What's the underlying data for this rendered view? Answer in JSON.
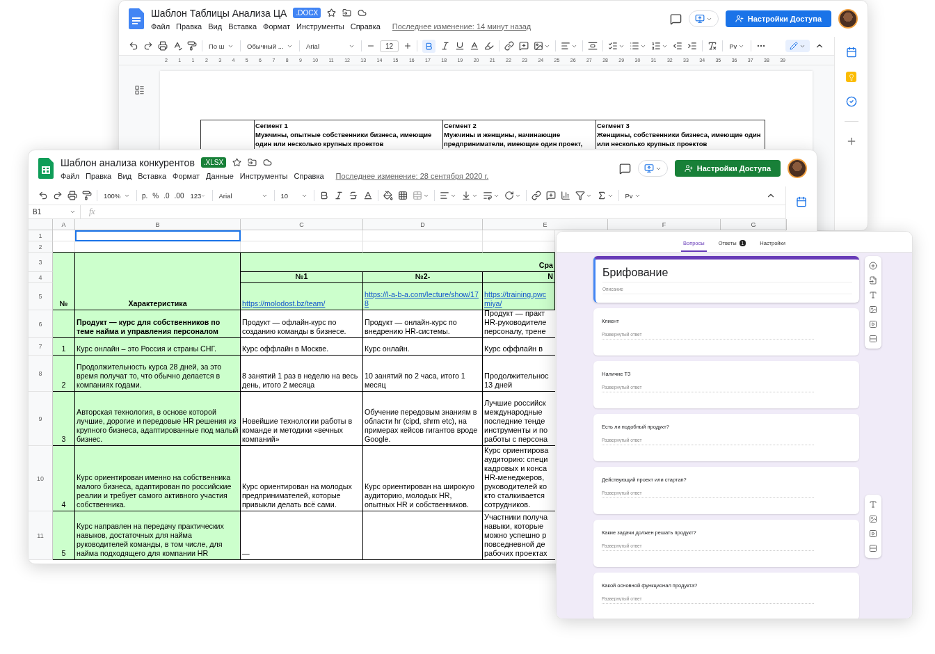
{
  "docs": {
    "title": "Шаблон Таблицы Анализа ЦА",
    "badge": ".DOCX",
    "menus": [
      "Файл",
      "Правка",
      "Вид",
      "Вставка",
      "Формат",
      "Инструменты",
      "Справка"
    ],
    "last_edit": "Последнее изменение: 14 минут назад",
    "share": "Настройки Доступа",
    "toolbar": {
      "style_short": "По ш",
      "paragraph_style": "Обычный ...",
      "font": "Arial",
      "font_size": "12",
      "bold_active": true,
      "input_tools": "Рv"
    },
    "ruler": [
      "2",
      "1",
      "1",
      "2",
      "3",
      "4",
      "5",
      "6",
      "7",
      "8",
      "9",
      "10",
      "11",
      "12",
      "13",
      "14",
      "15",
      "16",
      "17",
      "18",
      "19",
      "20",
      "21",
      "22",
      "23",
      "24",
      "25",
      "26",
      "27",
      "28",
      "29",
      "30",
      "31",
      "32",
      "33",
      "34",
      "35",
      "36",
      "37",
      "38",
      "39"
    ],
    "table": [
      {
        "title": "Сегмент 1",
        "text": "Мужчины, опытные собственники бизнеса, имеющие один или несколько крупных проектов"
      },
      {
        "title": "Сегмент 2",
        "text": "Мужчины и женщины, начинающие предприниматели, имеющие один проект,"
      },
      {
        "title": "Сегмент 3",
        "text": "Женщины, собственники бизнеса, имеющие один или несколько крупных проектов"
      }
    ]
  },
  "sheets": {
    "title": "Шаблон анализа конкурентов",
    "badge": ".XLSX",
    "menus": [
      "Файл",
      "Правка",
      "Вид",
      "Вставка",
      "Формат",
      "Данные",
      "Инструменты",
      "Справка"
    ],
    "last_edit": "Последнее изменение: 28 сентября 2020 г.",
    "share": "Настройки Доступа",
    "toolbar": {
      "zoom": "100%",
      "currency": "р.",
      "percent": "%",
      "decrease_decimal": ".0",
      "increase_decimal": ".00",
      "number_format": "123",
      "font": "Arial",
      "font_size": "10",
      "input_tools": "Рv"
    },
    "name_box": "B1",
    "formula_icon": "fx",
    "columns": [
      "A",
      "B",
      "C",
      "D",
      "E",
      "F",
      "G"
    ],
    "row_numbers": [
      "1",
      "2",
      "3",
      "4",
      "5",
      "6",
      "7",
      "8",
      "9",
      "10",
      "11"
    ],
    "blank_rows": [
      {
        "selected": true
      },
      {
        "selected": false
      }
    ],
    "header": {
      "number": "№",
      "characteristic": "Характеристика",
      "compare": "Сра",
      "competitors": [
        {
          "name": "№1",
          "link": [
            "https://molodost.bz/team/"
          ]
        },
        {
          "name": "№2-",
          "link": [
            "https://l-a-b-a.com/lecture/show/178"
          ]
        },
        {
          "name": "N",
          "link": [
            "https://training.pwc",
            "miya/"
          ]
        }
      ]
    },
    "rows": [
      {
        "text": "Продукт — курс для собственников по теме найма и управления персоналом",
        "bold": true,
        "cells": [
          "Продукт — офлайн-курс по созданию команды в бизнесе.",
          "Продукт — онлайн-курс по внедрению HR-системы."
        ],
        "cut": [
          "Продукт — практ",
          "HR-руководителе",
          "персоналу, трене"
        ]
      },
      {
        "number": "1",
        "text": "Курс онлайн – это Россия и страны СНГ.",
        "bold": false,
        "cells": [
          "Курс оффлайн в Москве.",
          "Курс онлайн."
        ],
        "cut": [
          "Курс оффлайн в"
        ]
      },
      {
        "number": "2",
        "text": "Продолжительность курса 28 дней, за это время получат то, что обычно делается в компаниях годами.",
        "bold": false,
        "cells": [
          "8 занятий 1 раз в неделю на весь день, итого 2 месяца",
          "10 занятий по 2 часа, итого 1 месяц"
        ],
        "cut": [
          "Продолжительнос",
          "13 дней"
        ]
      },
      {
        "number": "3",
        "text": "Авторская технология, в основе которой лучшие, дорогие и передовые HR решения из крупного бизнеса, адаптированные под малый бизнес.",
        "bold": false,
        "cells": [
          "Новейшие технологии работы в команде и методики «вечных компаний»",
          "Обучение передовым знаниям в области hr (cipd, shrm etc), на примерах кейсов гигантов вроде Google."
        ],
        "cut": [
          "Лучшие российск",
          "международные",
          "последние тенде",
          "инструменты и по",
          "работы с персона"
        ]
      },
      {
        "number": "4",
        "text": "Курс ориентирован именно на собственника малого бизнеса, адаптирован по российские реалии и требует самого активного участия собственника.",
        "bold": false,
        "cells": [
          "Курс ориентирован на молодых предпринимателей, которые привыкли делать всё сами.",
          "Курс ориентирован на широкую аудиторию, молодых HR, опытных HR и собственников."
        ],
        "cut": [
          "Курс ориентирова",
          "аудиторию: специ",
          "кадровых и конса",
          "HR-менеджеров,",
          "руководителей ко",
          "кто сталкивается",
          "сотрудников."
        ]
      },
      {
        "number": "5",
        "text": "Курс направлен на передачу практических навыков, достаточных для найма руководителей команды, в том числе, для найма подходящего для компании HR",
        "bold": false,
        "cells": [
          "—"
        ],
        "cut": [
          "Участники получа",
          "навыки, которые",
          "можно успешно р",
          "повседневной де",
          "рабочих проектах"
        ]
      }
    ]
  },
  "forms": {
    "tabs": [
      {
        "label": "Вопросы",
        "selected": true
      },
      {
        "label": "Ответы",
        "selected": false,
        "badge": "1"
      },
      {
        "label": "Настройки",
        "selected": false
      }
    ],
    "title": "Брифование",
    "description": "Описание",
    "questions": [
      {
        "title": "Клиент",
        "placeholder": "Развернутый ответ"
      },
      {
        "title": "Наличие ТЗ",
        "placeholder": "Развернутый ответ"
      },
      {
        "title": "Есть ли подобный продукт?",
        "placeholder": "Развернутый ответ"
      },
      {
        "title": "Действующий проект или стартап?",
        "placeholder": "Развернутый ответ"
      },
      {
        "title": "Какие задачи должен решать продукт?",
        "placeholder": "Развернутый ответ"
      },
      {
        "title": "Какой основной функционал продукта?",
        "placeholder": "Развернутый ответ"
      }
    ]
  }
}
